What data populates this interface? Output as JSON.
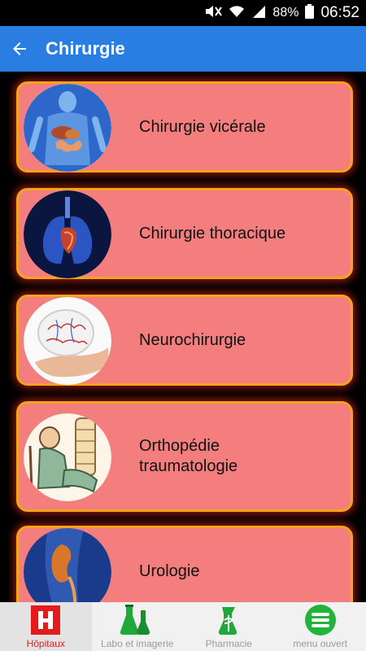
{
  "status_bar": {
    "battery": "88%",
    "time": "06:52"
  },
  "app_bar": {
    "title": "Chirurgie"
  },
  "specialties": [
    {
      "label": "Chirurgie vicérale",
      "image": "digestive-system-image"
    },
    {
      "label": "Chirurgie thoracique",
      "image": "lungs-heart-image"
    },
    {
      "label": "Neurochirurgie",
      "image": "brain-in-hand-image"
    },
    {
      "label": "Orthopédie\ntraumatologie",
      "image": "bandaged-patient-image"
    },
    {
      "label": "Urologie",
      "image": "kidney-image"
    }
  ],
  "bottom_nav": [
    {
      "label": "Hôpitaux",
      "icon": "hospital-icon",
      "active": true
    },
    {
      "label": "Labo et imagerie",
      "icon": "flasks-icon",
      "active": false
    },
    {
      "label": "Pharmacie",
      "icon": "pharmacy-icon",
      "active": false
    },
    {
      "label": "menu ouvert",
      "icon": "menu-icon",
      "active": false
    }
  ],
  "colors": {
    "app_bar": "#2a7de1",
    "card_fill": "#f47e7e",
    "card_border": "#f5a21c",
    "active_nav": "#d22222"
  }
}
